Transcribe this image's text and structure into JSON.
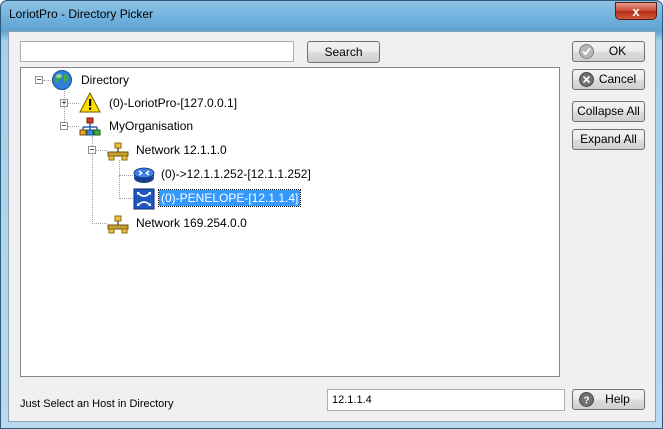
{
  "window": {
    "title": "LoriotPro - Directory Picker",
    "close_glyph": "x"
  },
  "search": {
    "value": "",
    "button_label": "Search"
  },
  "tree": {
    "root": "Directory",
    "loriotpro": "(0)-LoriotPro-[127.0.0.1]",
    "organisation": "MyOrganisation",
    "network1": "Network 12.1.1.0",
    "router": "(0)->12.1.1.252-[12.1.1.252]",
    "selected_host": "(0)-PENELOPE-[12.1.1.4]",
    "network2": "Network 169.254.0.0",
    "icons": {
      "root": "globe-icon",
      "loriotpro": "warning-icon",
      "organisation": "org-chart-icon",
      "network": "network-icon",
      "router": "router-icon",
      "switch": "switch-icon"
    }
  },
  "buttons": {
    "ok_label": "OK",
    "cancel_label": "Cancel",
    "collapse_label": "Collapse All",
    "expand_label": "Expand All",
    "help_label": "Help"
  },
  "status": {
    "text": "Just Select an Host in Directory",
    "selected_value": "12.1.1.4"
  },
  "colors": {
    "selection": "#3399ff",
    "title_bar": "#6fb0dc"
  }
}
